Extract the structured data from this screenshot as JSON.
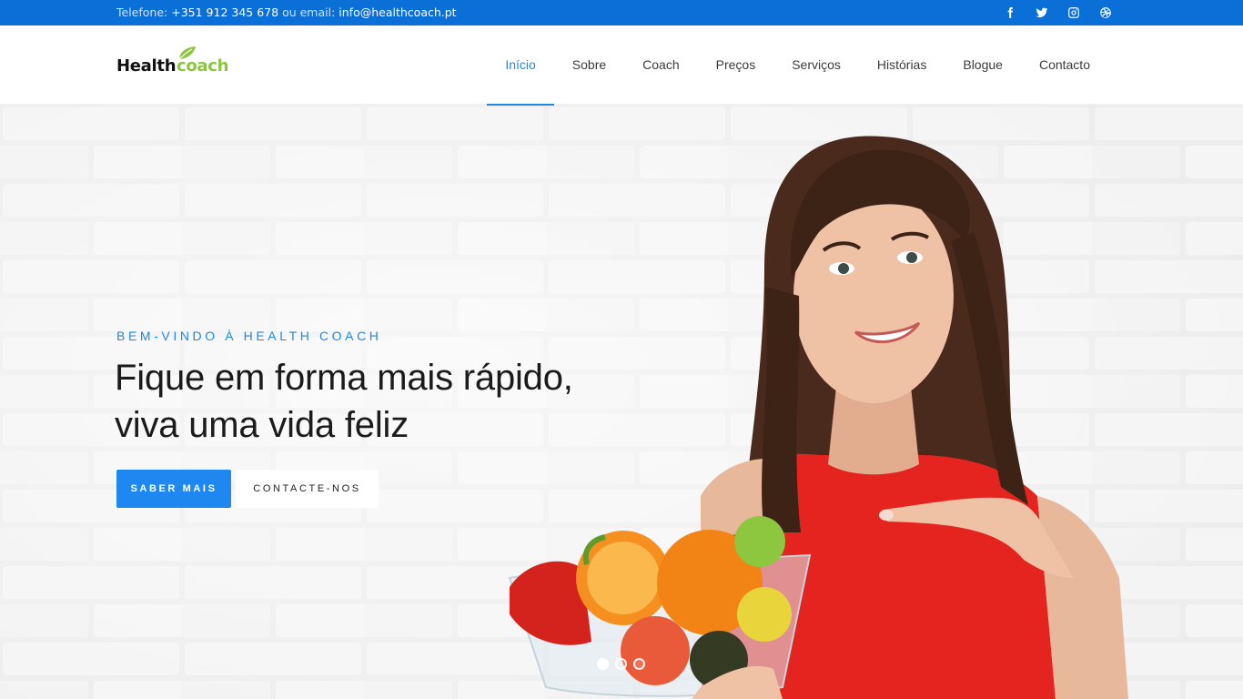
{
  "topbar": {
    "phone_label": "Telefone:",
    "phone": "+351 912 345 678",
    "email_label": "ou email:",
    "email": "info@healthcoach.pt",
    "social": [
      "facebook-icon",
      "twitter-icon",
      "instagram-icon",
      "dribbble-icon"
    ]
  },
  "brand": {
    "part1": "Health",
    "part2": "coach",
    "accent": "#8cc63f"
  },
  "nav": {
    "items": [
      {
        "label": "Início",
        "active": true
      },
      {
        "label": "Sobre"
      },
      {
        "label": "Coach"
      },
      {
        "label": "Preços"
      },
      {
        "label": "Serviços"
      },
      {
        "label": "Histórias"
      },
      {
        "label": "Blogue"
      },
      {
        "label": "Contacto"
      }
    ]
  },
  "hero": {
    "eyebrow": "BEM-VINDO À HEALTH COACH",
    "headline_line1": "Fique em forma mais rápido,",
    "headline_line2": "viva uma vida feliz",
    "primary_button": "SABER MAIS",
    "secondary_button": "CONTACTE-NOS",
    "slides_total": 3,
    "slide_active": 1
  },
  "colors": {
    "topbar": "#0b6fd8",
    "primary": "#1e88f0",
    "text": "#1b1b1b"
  }
}
